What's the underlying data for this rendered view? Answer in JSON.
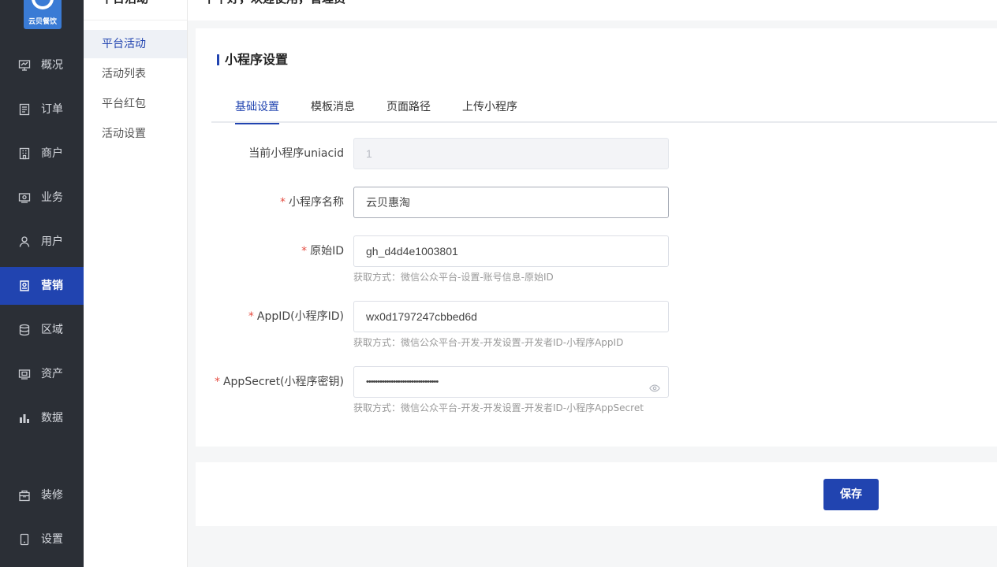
{
  "brand": {
    "logo_text": "云贝餐饮",
    "accent": "#2144b0"
  },
  "header": {
    "greeting": "下午好，欢迎使用，管理员"
  },
  "sidebar": {
    "items": [
      {
        "label": "概况",
        "icon": "chart-board-icon"
      },
      {
        "label": "订单",
        "icon": "order-list-icon"
      },
      {
        "label": "商户",
        "icon": "building-icon"
      },
      {
        "label": "业务",
        "icon": "briefcase-icon"
      },
      {
        "label": "用户",
        "icon": "user-icon"
      },
      {
        "label": "营销",
        "icon": "tag-icon",
        "active": true
      },
      {
        "label": "区域",
        "icon": "database-icon"
      },
      {
        "label": "资产",
        "icon": "wallet-icon"
      },
      {
        "label": "数据",
        "icon": "bar-chart-icon"
      },
      {
        "label": "装修",
        "icon": "store-icon"
      },
      {
        "label": "设置",
        "icon": "settings-phone-icon"
      }
    ]
  },
  "subnav": {
    "title": "平台活动",
    "items": [
      {
        "label": "平台活动",
        "active": true
      },
      {
        "label": "活动列表"
      },
      {
        "label": "平台红包"
      },
      {
        "label": "活动设置"
      }
    ]
  },
  "main": {
    "section_title": "小程序设置",
    "tabs": [
      {
        "label": "基础设置",
        "active": true
      },
      {
        "label": "模板消息"
      },
      {
        "label": "页面路径"
      },
      {
        "label": "上传小程序"
      }
    ],
    "fields": [
      {
        "label": "当前小程序uniacid",
        "required": false,
        "value": "1",
        "disabled": true,
        "hint": ""
      },
      {
        "label": "小程序名称",
        "required": true,
        "value": "云贝惠淘",
        "hint": ""
      },
      {
        "label": "原始ID",
        "required": true,
        "value": "gh_d4d4e1003801",
        "hint": "获取方式：微信公众平台-设置-账号信息-原始ID"
      },
      {
        "label": "AppID(小程序ID)",
        "required": true,
        "value": "wx0d1797247cbbed6d",
        "hint": "获取方式：微信公众平台-开发-开发设置-开发者ID-小程序AppID"
      },
      {
        "label": "AppSecret(小程序密钥)",
        "required": true,
        "value": "••••••••••••••••••••••••••••••••",
        "hint": "获取方式：微信公众平台-开发-开发设置-开发者ID-小程序AppSecret",
        "icon": "eye-icon"
      }
    ],
    "required_mark": "*"
  },
  "footer": {
    "save_label": "保存"
  }
}
